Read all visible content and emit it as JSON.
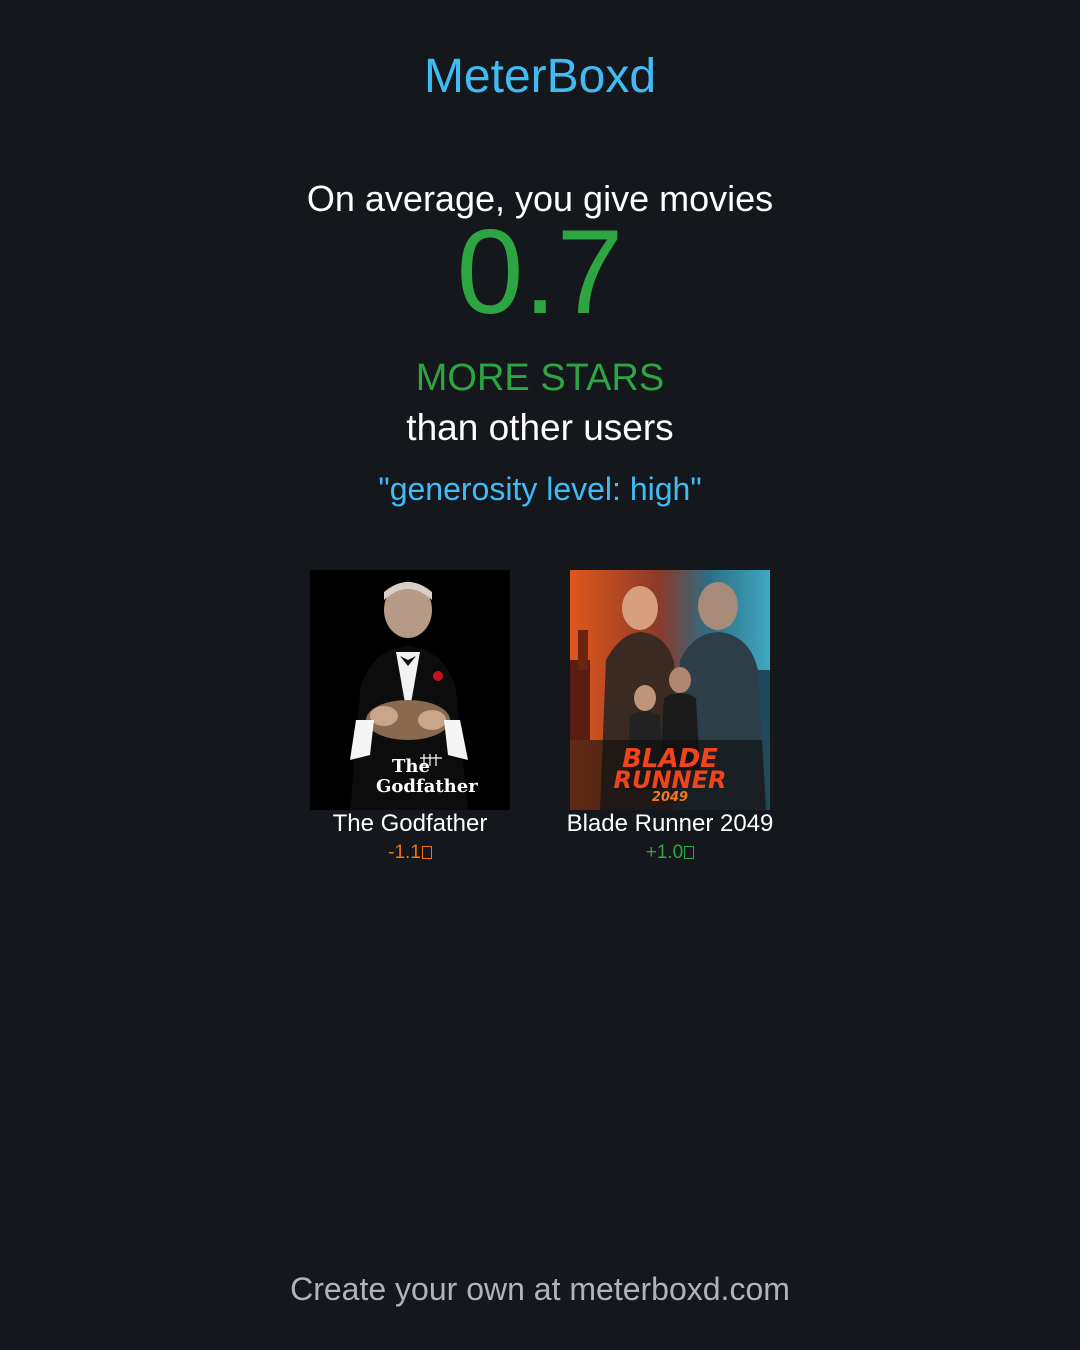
{
  "brand": "MeterBoxd",
  "intro": "On average, you give movies",
  "average_difference": "0.7",
  "direction": "MORE STARS",
  "comparison": "than other users",
  "quote": "\"generosity level: high\"",
  "movies": [
    {
      "title": "The Godfather",
      "delta": "-1.1",
      "poster_text": [
        "The",
        "Godfather"
      ]
    },
    {
      "title": "Blade Runner 2049",
      "delta": "+1.0",
      "poster_text": [
        "BLADE",
        "RUNNER",
        "2049"
      ]
    }
  ],
  "footer": "Create your own at meterboxd.com",
  "colors": {
    "background": "#14181c",
    "accent_blue": "#40bcf4",
    "accent_green": "#2da543",
    "accent_orange": "#f27405"
  }
}
